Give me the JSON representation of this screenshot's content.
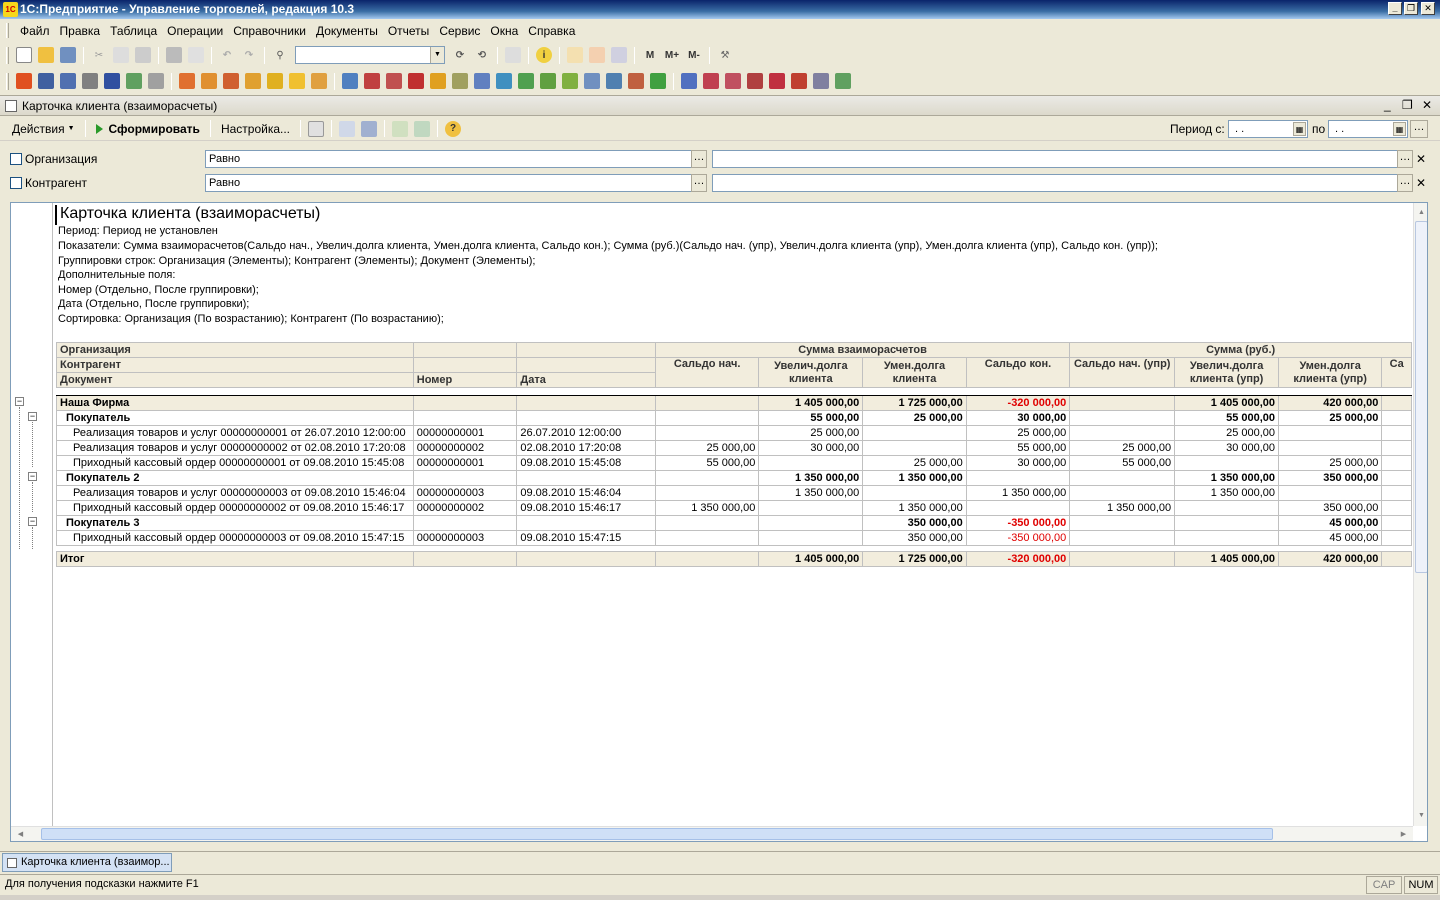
{
  "app": {
    "title": "1С:Предприятие - Управление торговлей, редакция 10.3",
    "logo": "1С"
  },
  "menu": [
    "Файл",
    "Правка",
    "Таблица",
    "Операции",
    "Справочники",
    "Документы",
    "Отчеты",
    "Сервис",
    "Окна",
    "Справка"
  ],
  "toolbar": {
    "search_value": "",
    "m_buttons": [
      "M",
      "M+",
      "M-"
    ]
  },
  "doc": {
    "title": "Карточка клиента (взаиморасчеты)"
  },
  "actions": {
    "actions_label": "Действия",
    "generate_label": "Сформировать",
    "settings_label": "Настройка...",
    "period_from_label": "Период с:",
    "period_to_label": "по",
    "period_from_value": " .  .",
    "period_to_value": " .  ."
  },
  "filters": [
    {
      "label": "Организация",
      "condition": "Равно",
      "value": ""
    },
    {
      "label": "Контрагент",
      "condition": "Равно",
      "value": ""
    }
  ],
  "report": {
    "title": "Карточка клиента (взаиморасчеты)",
    "info": [
      "Период: Период не установлен",
      "Показатели: Сумма взаиморасчетов(Сальдо нач., Увелич.долга клиента, Умен.долга клиента, Сальдо кон.); Сумма (руб.)(Сальдо нач. (упр), Увелич.долга клиента (упр), Умен.долга клиента (упр), Сальдо кон. (упр));",
      "Группировки строк: Организация (Элементы); Контрагент (Элементы); Документ (Элементы);",
      "Дополнительные поля:",
      "Номер (Отдельно, После группировки);",
      "Дата (Отдельно, После группировки);",
      "Сортировка: Организация (По возрастанию); Контрагент (По возрастанию);"
    ],
    "headers": {
      "organization": "Организация",
      "counterparty": "Контрагент",
      "document": "Документ",
      "number": "Номер",
      "date": "Дата",
      "group1": "Сумма взаиморасчетов",
      "group2": "Сумма (руб.)",
      "cols": [
        "Сальдо нач.",
        "Увелич.долга клиента",
        "Умен.долга клиента",
        "Сальдо кон.",
        "Сальдо нач. (упр)",
        "Увелич.долга клиента (упр)",
        "Умен.долга клиента (упр)",
        "Са"
      ]
    },
    "rows": [
      {
        "level": 0,
        "name": "Наша Фирма",
        "number": "",
        "date": "",
        "v": [
          "",
          "1 405 000,00",
          "1 725 000,00",
          "-320 000,00",
          "",
          "1 405 000,00",
          "420 000,00"
        ]
      },
      {
        "level": 1,
        "name": "Покупатель",
        "number": "",
        "date": "",
        "v": [
          "",
          "55 000,00",
          "25 000,00",
          "30 000,00",
          "",
          "55 000,00",
          "25 000,00"
        ]
      },
      {
        "level": 2,
        "name": "Реализация товаров и услуг 00000000001 от 26.07.2010 12:00:00",
        "number": "00000000001",
        "date": "26.07.2010 12:00:00",
        "v": [
          "",
          "25 000,00",
          "",
          "25 000,00",
          "",
          "25 000,00",
          ""
        ]
      },
      {
        "level": 2,
        "name": "Реализация товаров и услуг 00000000002 от 02.08.2010 17:20:08",
        "number": "00000000002",
        "date": "02.08.2010 17:20:08",
        "v": [
          "25 000,00",
          "30 000,00",
          "",
          "55 000,00",
          "25 000,00",
          "30 000,00",
          ""
        ]
      },
      {
        "level": 2,
        "name": "Приходный кассовый ордер 00000000001 от 09.08.2010 15:45:08",
        "number": "00000000001",
        "date": "09.08.2010 15:45:08",
        "v": [
          "55 000,00",
          "",
          "25 000,00",
          "30 000,00",
          "55 000,00",
          "",
          "25 000,00"
        ]
      },
      {
        "level": 1,
        "name": "Покупатель 2",
        "number": "",
        "date": "",
        "v": [
          "",
          "1 350 000,00",
          "1 350 000,00",
          "",
          "",
          "1 350 000,00",
          "350 000,00"
        ]
      },
      {
        "level": 2,
        "name": "Реализация товаров и услуг 00000000003 от 09.08.2010 15:46:04",
        "number": "00000000003",
        "date": "09.08.2010 15:46:04",
        "v": [
          "",
          "1 350 000,00",
          "",
          "1 350 000,00",
          "",
          "1 350 000,00",
          ""
        ]
      },
      {
        "level": 2,
        "name": "Приходный кассовый ордер 00000000002 от 09.08.2010 15:46:17",
        "number": "00000000002",
        "date": "09.08.2010 15:46:17",
        "v": [
          "1 350 000,00",
          "",
          "1 350 000,00",
          "",
          "1 350 000,00",
          "",
          "350 000,00"
        ]
      },
      {
        "level": 1,
        "name": "Покупатель 3",
        "number": "",
        "date": "",
        "v": [
          "",
          "",
          "350 000,00",
          "-350 000,00",
          "",
          "",
          "45 000,00"
        ]
      },
      {
        "level": 2,
        "name": "Приходный кассовый ордер 00000000003 от 09.08.2010 15:47:15",
        "number": "00000000003",
        "date": "09.08.2010 15:47:15",
        "v": [
          "",
          "",
          "350 000,00",
          "-350 000,00",
          "",
          "",
          "45 000,00"
        ]
      }
    ],
    "total": {
      "name": "Итог",
      "v": [
        "",
        "1 405 000,00",
        "1 725 000,00",
        "-320 000,00",
        "",
        "1 405 000,00",
        "420 000,00"
      ]
    }
  },
  "taskbar": {
    "window_label": "Карточка клиента (взаимор..."
  },
  "status": {
    "hint": "Для получения подсказки нажмите F1",
    "cap": "CAP",
    "num": "NUM"
  }
}
